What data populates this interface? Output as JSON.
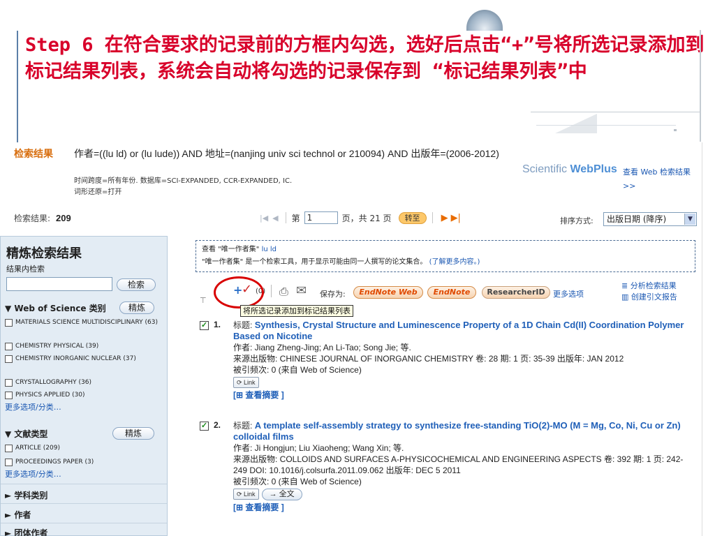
{
  "slide": {
    "title": "Step 6 在符合要求的记录前的方框内勾选，选好后点击“+”号将所选记录添加到标记结果列表，系统会自动将勾选的记录保存到 “标记结果列表”中"
  },
  "header": {
    "label": "检索结果",
    "query": "作者=((lu ld) or (lu lude)) AND 地址=(nanjing univ sci technol or 210094) AND 出版年=(2006-2012)",
    "timespan": "时间跨度=所有年份. 数据库=SCI-EXPANDED, CCR-EXPANDED, IC.",
    "lemmatization": "词形还原=打开",
    "webplus_a": "Scientific ",
    "webplus_b": "WebPlus",
    "webplus_link": "查看 Web 检索结果 >>"
  },
  "results": {
    "count_label": "检索结果:",
    "count": "209",
    "page_prefix": "第",
    "page_value": "1",
    "page_suffix": "页，共 21 页",
    "go": "转至",
    "sort_label": "排序方式:",
    "sort_value": "出版日期 (降序)"
  },
  "sidebar": {
    "title": "精炼检索结果",
    "search_within": "结果内检索",
    "search_button": "检索",
    "wos_category": "Web of Science 类别",
    "refine": "精炼",
    "categories": [
      "MATERIALS SCIENCE MULTIDISCIPLINARY (63)",
      "CHEMISTRY PHYSICAL (39)",
      "CHEMISTRY INORGANIC NUCLEAR (37)",
      "CRYSTALLOGRAPHY (36)",
      "PHYSICS APPLIED (30)"
    ],
    "more": "更多选项/分类…",
    "doc_type": "文献类型",
    "doc_types": [
      "ARTICLE (209)",
      "PROCEEDINGS PAPER (3)"
    ],
    "collapsed": [
      "学科类别",
      "作者",
      "团体作者"
    ]
  },
  "notice": {
    "line1_prefix": "查看 \"唯一作者集\"",
    "line1_link": "lu ld",
    "line2": "\"唯一作者集\" 是一个检索工具，用于显示可能由同一人撰写的论文集合。",
    "line2_link": "(了解更多内容。)"
  },
  "toolbar": {
    "marked": "(0)",
    "save_as": "保存为:",
    "endnote_web": "EndNote Web",
    "endnote": "EndNote",
    "researcher_id": "ResearcherID",
    "more": "更多选项",
    "analyze": "分析检索结果",
    "citation_report": "创建引文报告",
    "tooltip": "将所选记录添加到标记结果列表"
  },
  "records": [
    {
      "num": "1.",
      "title_label": "标题:",
      "title": "Synthesis, Crystal Structure and Luminescence Property of a 1D Chain Cd(II) Coordination Polymer Based on Nicotine",
      "authors": "作者: Jiang Zheng-Jing; An Li-Tao; Song Jie; 等.",
      "source": "来源出版物: CHINESE JOURNAL OF INORGANIC CHEMISTRY 卷: 28 期: 1 页: 35-39 出版年: JAN 2012",
      "cited": "被引频次: 0 (来自 Web of Science)",
      "link": "Link",
      "abstract": "[⊞ 查看摘要 ]"
    },
    {
      "num": "2.",
      "title_label": "标题:",
      "title": "A template self-assembly strategy to synthesize free-standing TiO(2)-MO (M = Mg, Co, Ni, Cu or Zn) colloidal films",
      "authors": "作者: Ji Hongjun; Liu Xiaoheng; Wang Xin; 等.",
      "source": "来源出版物: COLLOIDS AND SURFACES A-PHYSICOCHEMICAL AND ENGINEERING ASPECTS 卷: 392 期: 1 页: 242-249 DOI: 10.1016/j.colsurfa.2011.09.062 出版年: DEC 5 2011",
      "cited": "被引频次: 0 (来自 Web of Science)",
      "link": "Link",
      "fulltext": "→ 全文",
      "abstract": "[⊞ 查看摘要 ]"
    }
  ]
}
